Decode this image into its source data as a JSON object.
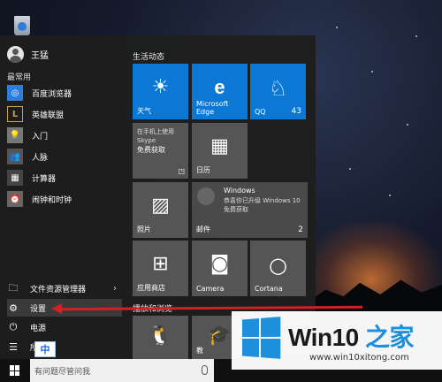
{
  "user": {
    "name": "王猛"
  },
  "left": {
    "section_label": "最常用",
    "apps": [
      {
        "label": "百度浏览器",
        "icon": "baidu-browser-icon",
        "color": "#2b7de0"
      },
      {
        "label": "英雄联盟",
        "icon": "league-of-legends-icon",
        "color": "#c9a53a"
      },
      {
        "label": "入门",
        "icon": "get-started-icon",
        "color": "#777"
      },
      {
        "label": "人脉",
        "icon": "people-icon",
        "color": "#555"
      },
      {
        "label": "计算器",
        "icon": "calculator-icon",
        "color": "#444"
      },
      {
        "label": "闹钟和时钟",
        "icon": "alarm-clock-icon",
        "color": "#666"
      }
    ],
    "bottom": {
      "file_explorer": "文件资源管理器",
      "settings": "设置",
      "power": "电源",
      "all_apps": "所有"
    }
  },
  "tiles": {
    "group1_title": "生活动态",
    "weather": "天气",
    "edge": "Microsoft Edge",
    "qq": "QQ",
    "qq_badge": "43",
    "skype_text": "在手机上使用 Skype",
    "skype_sub": "免费获取",
    "calendar": "日历",
    "windows_title": "Windows",
    "windows_line1": "恭喜你已升级 Windows 10",
    "windows_line2": "免费获取",
    "photos": "照片",
    "mail": "邮件",
    "mail_badge": "2",
    "store": "应用商店",
    "camera": "Camera",
    "cortana": "Cortana",
    "group2_title": "播放和浏览",
    "partial_label": "教"
  },
  "taskbar": {
    "search_placeholder": "有问题尽管问我",
    "ime": "中"
  },
  "watermark": {
    "title_prefix": "Win10",
    "title_suffix": " 之家",
    "url": "www.win10xitong.com"
  },
  "colors": {
    "tile_blue": "#0a78d4",
    "arrow_red": "#d32020",
    "watermark_blue": "#1d8fdc"
  }
}
